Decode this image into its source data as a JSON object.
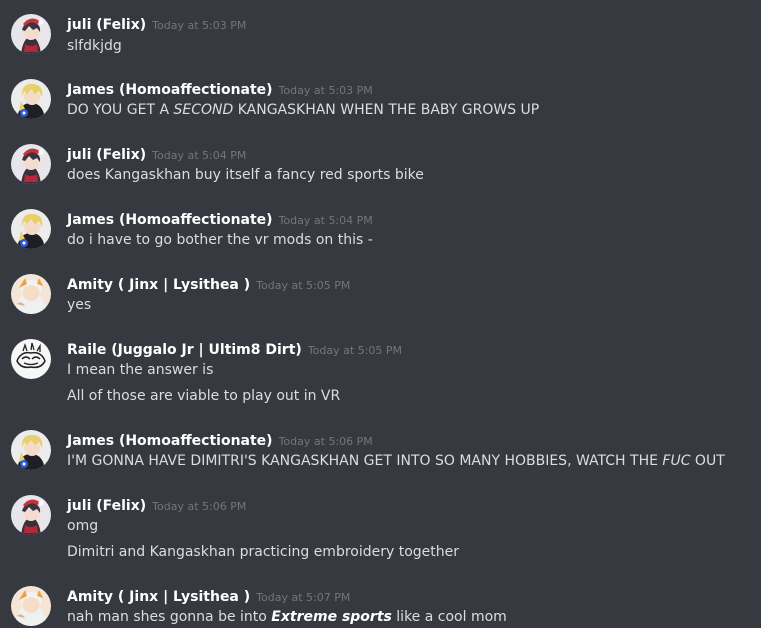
{
  "colors": {
    "background": "#36393f",
    "username": "#ffffff",
    "text": "#dcddde",
    "timestamp": "#72767d"
  },
  "messages": [
    {
      "avatar": "juli-avatar",
      "author": "juli (Felix)",
      "time": "Today at 5:03 PM",
      "lines": [
        "slfdkjdg"
      ]
    },
    {
      "avatar": "james-avatar",
      "author": "James (Homoaffectionate)",
      "time": "Today at 5:03 PM",
      "line_parts": {
        "a": "DO YOU GET A ",
        "em": "SECOND",
        "b": " KANGASKHAN WHEN THE BABY GROWS UP"
      }
    },
    {
      "avatar": "juli-avatar",
      "author": "juli (Felix)",
      "time": "Today at 5:04 PM",
      "lines": [
        "does Kangaskhan buy itself a fancy red sports bike"
      ]
    },
    {
      "avatar": "james-avatar",
      "author": "James (Homoaffectionate)",
      "time": "Today at 5:04 PM",
      "lines": [
        "do i have to go bother the vr mods on this -"
      ]
    },
    {
      "avatar": "amity-avatar",
      "author": "Amity ( Jinx | Lysithea )",
      "time": "Today at 5:05 PM",
      "lines": [
        "yes"
      ]
    },
    {
      "avatar": "raile-avatar",
      "author": "Raile (Juggalo Jr | Ultim8 Dirt)",
      "time": "Today at 5:05 PM",
      "lines": [
        "I mean the answer is",
        "All of those are viable to play out in VR"
      ]
    },
    {
      "avatar": "james-avatar",
      "author": "James (Homoaffectionate)",
      "time": "Today at 5:06 PM",
      "line_parts": {
        "a": "I'M GONNA HAVE DIMITRI'S KANGASKHAN GET INTO SO MANY HOBBIES, WATCH THE ",
        "em": "FUC",
        "b": " OUT"
      }
    },
    {
      "avatar": "juli-avatar",
      "author": "juli (Felix)",
      "time": "Today at 5:06 PM",
      "lines": [
        "omg",
        "Dimitri and Kangaskhan practicing embroidery together"
      ]
    },
    {
      "avatar": "amity-avatar",
      "author": "Amity ( Jinx | Lysithea )",
      "time": "Today at 5:07 PM",
      "line_parts": {
        "a": "nah man shes gonna be into ",
        "em": "Extreme sports",
        "b": " like a cool mom"
      }
    }
  ]
}
